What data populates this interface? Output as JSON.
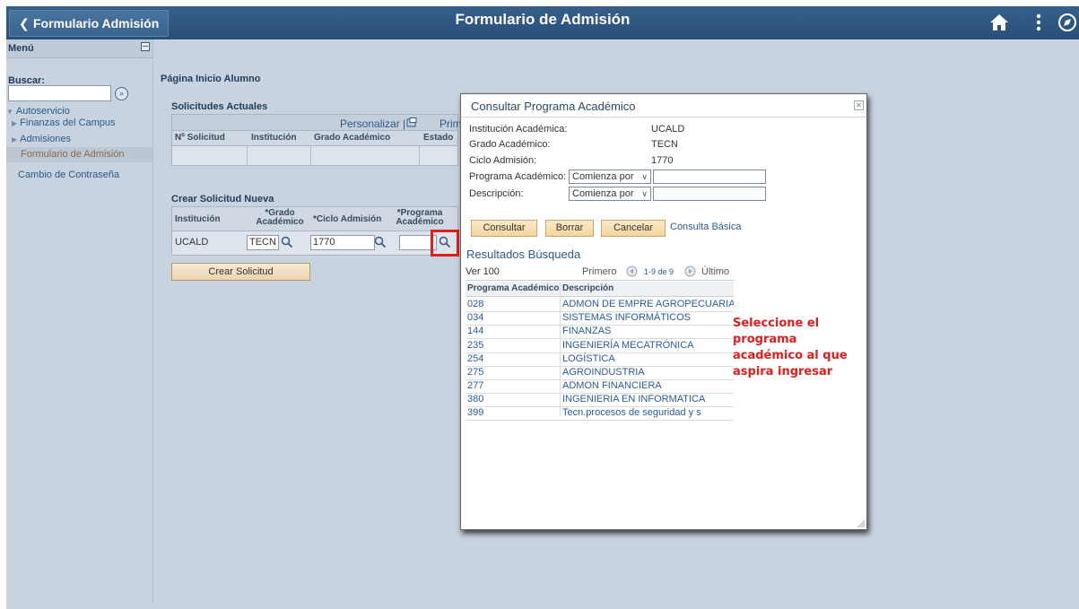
{
  "header": {
    "back_label": "Formulario Admisión",
    "title": "Formulario de Admisión",
    "icons": [
      "home-icon",
      "actions-menu-icon",
      "navbar-icon"
    ]
  },
  "sidebar": {
    "menu_label": "Menú",
    "search_label": "Buscar:",
    "search_value": "",
    "items": [
      {
        "label": "Autoservicio"
      },
      {
        "label": "Finanzas del Campus"
      },
      {
        "label": "Admisiones"
      },
      {
        "label": "Formulario de Admisión"
      },
      {
        "label": "Cambio de Contraseña"
      }
    ]
  },
  "main": {
    "page_title": "Página Inicio Alumno",
    "current": {
      "title": "Solicitudes Actuales",
      "personalize": "Personalizar |",
      "first": "Prim",
      "columns": [
        "Nº Solicitud",
        "Institución",
        "Grado Académico",
        "Estado"
      ]
    },
    "new": {
      "title": "Crear Solicitud Nueva",
      "columns": [
        "Institución",
        "*Grado Académico",
        "*Ciclo Admisión",
        "*Programa Académico"
      ],
      "institution": "UCALD",
      "grado": "TECN",
      "ciclo": "1770",
      "programa": "",
      "create_button": "Crear Solicitud"
    }
  },
  "modal": {
    "title": "Consultar Programa Académico",
    "fields": [
      {
        "label": "Institución Académica:",
        "value": "UCALD"
      },
      {
        "label": "Grado Académico:",
        "value": "TECN"
      },
      {
        "label": "Ciclo Admisión:",
        "value": "1770"
      }
    ],
    "programa_label": "Programa Académico:",
    "programa_op": "Comienza por",
    "programa_value": "",
    "desc_label": "Descripción:",
    "desc_op": "Comienza por",
    "desc_value": "",
    "buttons": {
      "search": "Consultar",
      "clear": "Borrar",
      "cancel": "Cancelar",
      "basic": "Consulta Básica"
    },
    "results_title": "Resultados Búsqueda",
    "nav": {
      "view": "Ver 100",
      "first": "Primero",
      "range": "1-9 de 9",
      "last": "Último"
    },
    "columns": [
      "Programa Académico",
      "Descripción"
    ],
    "rows": [
      [
        "028",
        "ADMON DE EMPRE AGROPECUARIAS"
      ],
      [
        "034",
        "SISTEMAS INFORMÁTICOS"
      ],
      [
        "144",
        "FINANZAS"
      ],
      [
        "235",
        "INGENIERÍA MECATRÓNICA"
      ],
      [
        "254",
        "LOGÍSTICA"
      ],
      [
        "275",
        "AGROINDUSTRIA"
      ],
      [
        "277",
        "ADMON FINANCIERA"
      ],
      [
        "380",
        "INGENIERIA EN INFORMATICA"
      ],
      [
        "399",
        "Tecn.procesos de seguridad y s"
      ]
    ]
  },
  "annotation": "Seleccione el programa académico al que aspira ingresar",
  "colors": {
    "header": "#2a5580",
    "background": "#c9d3df",
    "highlight": "#e31c1c"
  }
}
